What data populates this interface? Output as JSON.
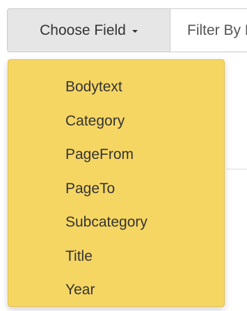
{
  "toolbar": {
    "choose_field_label": "Choose Field",
    "filter_placeholder": "Filter By Keyword"
  },
  "dropdown": {
    "items": [
      {
        "label": "Bodytext"
      },
      {
        "label": "Category"
      },
      {
        "label": "PageFrom"
      },
      {
        "label": "PageTo"
      },
      {
        "label": "Subcategory"
      },
      {
        "label": "Title"
      },
      {
        "label": "Year"
      }
    ]
  },
  "colors": {
    "dropdown_background": "#f6d663",
    "button_background": "#e6e6e6"
  },
  "icons": {
    "button_caret": "caret-down-icon"
  }
}
